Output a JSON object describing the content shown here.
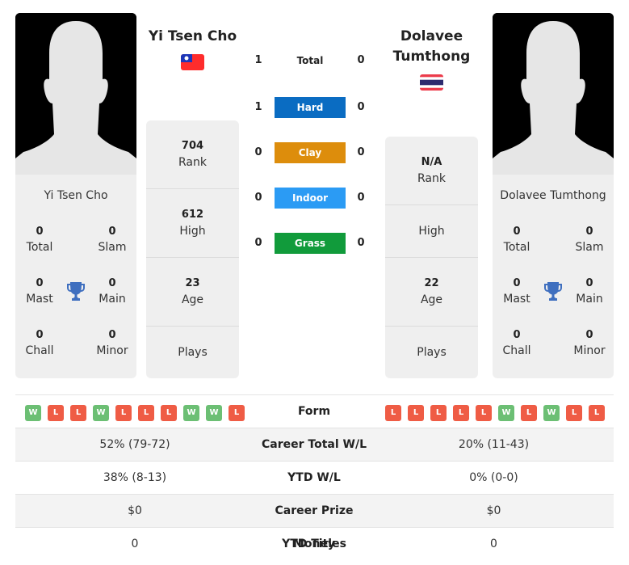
{
  "colors": {
    "hard": "#0a6cc2",
    "clay": "#dd8d0c",
    "indoor": "#2b9bf4",
    "grass": "#119b3b",
    "win": "#6cbf74",
    "loss": "#ef5c45",
    "trophy": "#3f6fbf"
  },
  "player1": {
    "name": "Yi Tsen Cho",
    "flag": "taiwan-flag",
    "card_name": "Yi Tsen Cho",
    "titles": {
      "total": {
        "value": "0",
        "label": "Total"
      },
      "slam": {
        "value": "0",
        "label": "Slam"
      },
      "mast": {
        "value": "0",
        "label": "Mast"
      },
      "main": {
        "value": "0",
        "label": "Main"
      },
      "chall": {
        "value": "0",
        "label": "Chall"
      },
      "minor": {
        "value": "0",
        "label": "Minor"
      }
    },
    "stats": [
      {
        "value": "704",
        "label": "Rank"
      },
      {
        "value": "612",
        "label": "High"
      },
      {
        "value": "23",
        "label": "Age"
      },
      {
        "value": "",
        "label": "Plays"
      }
    ],
    "form": [
      "W",
      "L",
      "L",
      "W",
      "L",
      "L",
      "L",
      "W",
      "W",
      "L"
    ]
  },
  "player2": {
    "name": "Dolavee Tumthong",
    "name_line1": "Dolavee",
    "name_line2": "Tumthong",
    "flag": "thailand-flag",
    "card_name": "Dolavee Tumthong",
    "titles": {
      "total": {
        "value": "0",
        "label": "Total"
      },
      "slam": {
        "value": "0",
        "label": "Slam"
      },
      "mast": {
        "value": "0",
        "label": "Mast"
      },
      "main": {
        "value": "0",
        "label": "Main"
      },
      "chall": {
        "value": "0",
        "label": "Chall"
      },
      "minor": {
        "value": "0",
        "label": "Minor"
      }
    },
    "stats": [
      {
        "value": "N/A",
        "label": "Rank"
      },
      {
        "value": "",
        "label": "High"
      },
      {
        "value": "22",
        "label": "Age"
      },
      {
        "value": "",
        "label": "Plays"
      }
    ],
    "form": [
      "L",
      "L",
      "L",
      "L",
      "L",
      "W",
      "L",
      "W",
      "L",
      "L"
    ]
  },
  "h2h": [
    {
      "label": "Total",
      "left": "1",
      "right": "0",
      "surface": "total"
    },
    {
      "label": "Hard",
      "left": "1",
      "right": "0",
      "surface": "hard"
    },
    {
      "label": "Clay",
      "left": "0",
      "right": "0",
      "surface": "clay"
    },
    {
      "label": "Indoor",
      "left": "0",
      "right": "0",
      "surface": "indoor"
    },
    {
      "label": "Grass",
      "left": "0",
      "right": "0",
      "surface": "grass"
    }
  ],
  "table": {
    "form_label": "Form",
    "rows": [
      {
        "label": "Career Total W/L",
        "left": "52% (79-72)",
        "right": "20% (11-43)"
      },
      {
        "label": "YTD W/L",
        "left": "38% (8-13)",
        "right": "0% (0-0)"
      },
      {
        "label": "Career Prize Money",
        "left": "$0",
        "right": "$0"
      },
      {
        "label": "YTD Titles",
        "left": "0",
        "right": "0"
      }
    ]
  }
}
